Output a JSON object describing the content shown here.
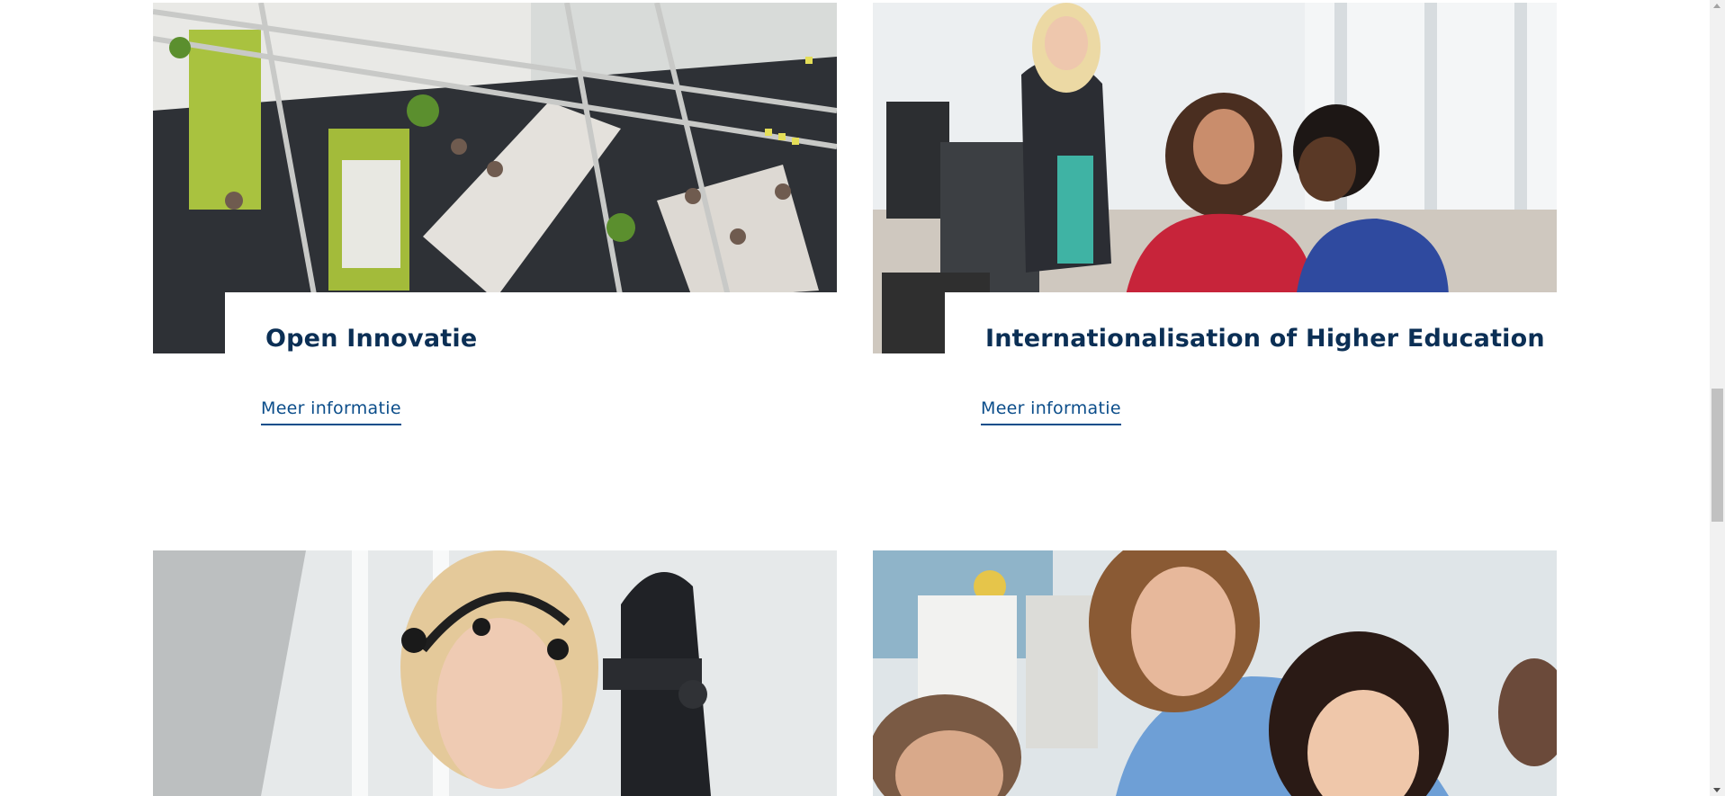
{
  "cards": [
    {
      "title": "Open Innovatie",
      "link_label": "Meer informatie",
      "image": "photo-office-meeting"
    },
    {
      "title": "Internationalisation of Higher Education",
      "link_label": "Meer informatie",
      "image": "photo-students-computer"
    }
  ],
  "lower_cards": [
    {
      "image": "photo-eeg-headset"
    },
    {
      "image": "photo-teacher-student"
    }
  ],
  "colors": {
    "title": "#0b2f55",
    "link": "#0b4d8a",
    "background": "#ffffff"
  }
}
